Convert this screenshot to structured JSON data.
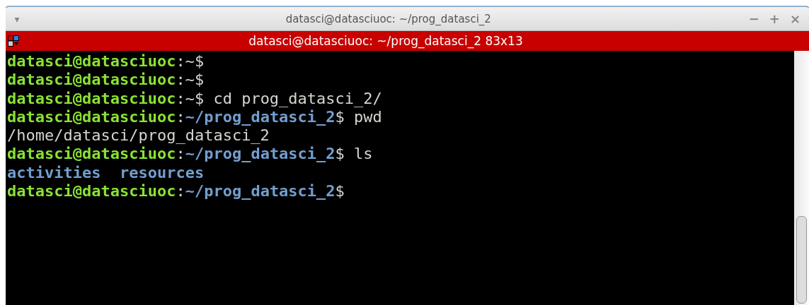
{
  "window": {
    "title": "datasci@datasciuoc: ~/prog_datasci_2",
    "menu_glyph": "▾",
    "controls": [
      "−",
      "+",
      "×"
    ]
  },
  "terminal": {
    "title": "datasci@datasciuoc: ~/prog_datasci_2 83x13",
    "lines": [
      [
        {
          "kind": "user",
          "text": "datasci@datasciuoc"
        },
        {
          "kind": "plain",
          "text": ":~$"
        }
      ],
      [
        {
          "kind": "user",
          "text": "datasci@datasciuoc"
        },
        {
          "kind": "plain",
          "text": ":~$"
        }
      ],
      [
        {
          "kind": "user",
          "text": "datasci@datasciuoc"
        },
        {
          "kind": "plain",
          "text": ":~$ cd prog_datasci_2/"
        }
      ],
      [
        {
          "kind": "user",
          "text": "datasci@datasciuoc"
        },
        {
          "kind": "plain",
          "text": ":"
        },
        {
          "kind": "path",
          "text": "~/prog_datasci_2"
        },
        {
          "kind": "plain",
          "text": "$ pwd"
        }
      ],
      [
        {
          "kind": "plain",
          "text": "/home/datasci/prog_datasci_2"
        }
      ],
      [
        {
          "kind": "user",
          "text": "datasci@datasciuoc"
        },
        {
          "kind": "plain",
          "text": ":"
        },
        {
          "kind": "path",
          "text": "~/prog_datasci_2"
        },
        {
          "kind": "plain",
          "text": "$ ls"
        }
      ],
      [
        {
          "kind": "dir",
          "text": "activities"
        },
        {
          "kind": "dir",
          "text": "resources"
        }
      ],
      [
        {
          "kind": "user",
          "text": "datasci@datasciuoc"
        },
        {
          "kind": "plain",
          "text": ":"
        },
        {
          "kind": "path",
          "text": "~/prog_datasci_2"
        },
        {
          "kind": "plain",
          "text": "$"
        }
      ]
    ]
  }
}
